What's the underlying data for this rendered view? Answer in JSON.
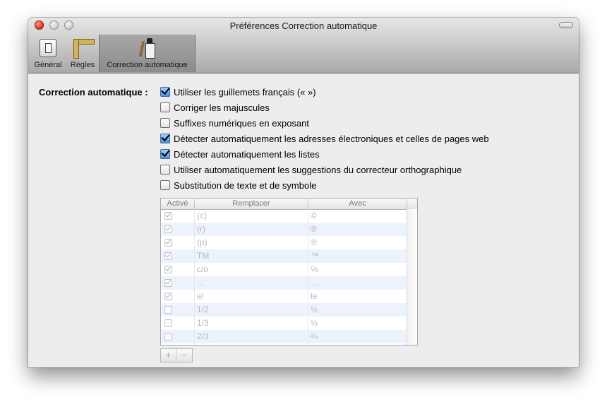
{
  "window": {
    "title": "Préférences Correction automatique"
  },
  "toolbar": {
    "items": [
      {
        "label": "Général",
        "icon": "general-switch-icon"
      },
      {
        "label": "Règles",
        "icon": "ruler-icon"
      },
      {
        "label": "Correction automatique",
        "icon": "correction-fluid-icon",
        "selected": true
      }
    ]
  },
  "section": {
    "label": "Correction automatique :"
  },
  "options": [
    {
      "label": "Utiliser les guillemets français (« »)",
      "checked": true
    },
    {
      "label": "Corriger les majuscules",
      "checked": false
    },
    {
      "label": "Suffixes numériques en exposant",
      "checked": false
    },
    {
      "label": "Détecter automatiquement les adresses électroniques et celles de pages web",
      "checked": true
    },
    {
      "label": "Détecter automatiquement les listes",
      "checked": true
    },
    {
      "label": "Utiliser automatiquement les suggestions du correcteur orthographique",
      "checked": false
    },
    {
      "label": "Substitution de texte et de symbole",
      "checked": false
    }
  ],
  "table": {
    "headers": {
      "active": "Activé",
      "replace": "Remplacer",
      "with": "Avec"
    },
    "rows": [
      {
        "active": true,
        "replace": "(c)",
        "with": "©"
      },
      {
        "active": true,
        "replace": "(r)",
        "with": "®"
      },
      {
        "active": true,
        "replace": "(p)",
        "with": "℗"
      },
      {
        "active": true,
        "replace": "TM",
        "with": "™"
      },
      {
        "active": true,
        "replace": "c/o",
        "with": "℅"
      },
      {
        "active": true,
        "replace": "...",
        "with": "…"
      },
      {
        "active": true,
        "replace": "el",
        "with": "le"
      },
      {
        "active": false,
        "replace": "1/2",
        "with": "½"
      },
      {
        "active": false,
        "replace": "1/3",
        "with": "⅓"
      },
      {
        "active": false,
        "replace": "2/3",
        "with": "⅔"
      }
    ]
  },
  "buttons": {
    "add": "+",
    "remove": "−"
  }
}
